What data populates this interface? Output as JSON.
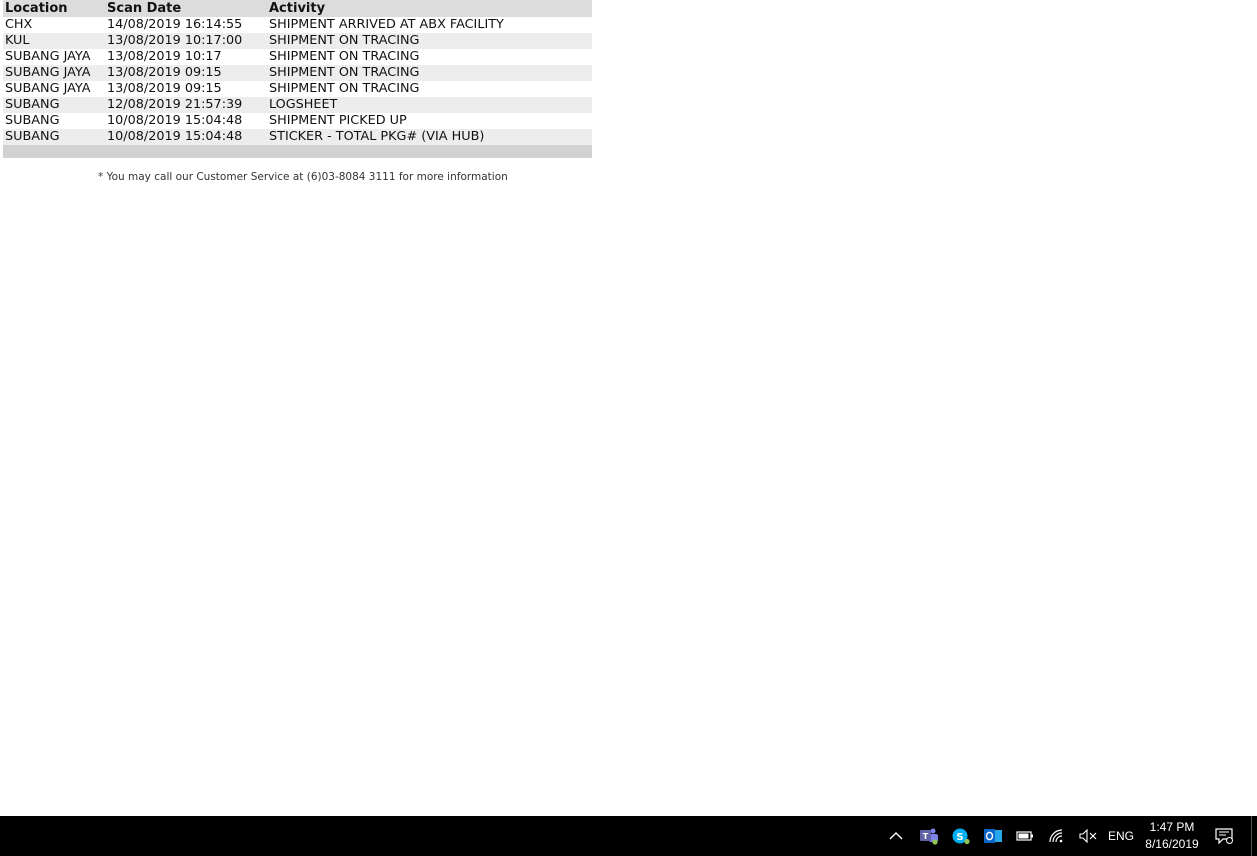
{
  "table": {
    "headers": [
      "Location",
      "Scan Date",
      "Activity"
    ],
    "rows": [
      [
        "CHX",
        "14/08/2019 16:14:55",
        "SHIPMENT ARRIVED AT ABX FACILITY"
      ],
      [
        "KUL",
        "13/08/2019 10:17:00",
        "SHIPMENT ON TRACING"
      ],
      [
        "SUBANG JAYA",
        "13/08/2019 10:17",
        "SHIPMENT ON TRACING"
      ],
      [
        "SUBANG JAYA",
        "13/08/2019 09:15",
        "SHIPMENT ON TRACING"
      ],
      [
        "SUBANG JAYA",
        "13/08/2019 09:15",
        "SHIPMENT ON TRACING"
      ],
      [
        "SUBANG",
        "12/08/2019 21:57:39",
        "LOGSHEET"
      ],
      [
        "SUBANG",
        "10/08/2019 15:04:48",
        "SHIPMENT PICKED UP"
      ],
      [
        "SUBANG",
        "10/08/2019 15:04:48",
        "STICKER - TOTAL PKG# (VIA HUB)"
      ]
    ]
  },
  "note": "* You may call our Customer Service at (6)03-8084 3111 for more information",
  "taskbar": {
    "language": "ENG",
    "time": "1:47 PM",
    "date": "8/16/2019",
    "icons": [
      "chevron-up-icon",
      "teams-icon",
      "skype-icon",
      "outlook-icon",
      "battery-icon",
      "wifi-icon",
      "volume-muted-icon",
      "notification-icon"
    ],
    "colors": {
      "teams": "#6264a7",
      "skype": "#00aff0",
      "outlook": "#0a64c8"
    }
  }
}
